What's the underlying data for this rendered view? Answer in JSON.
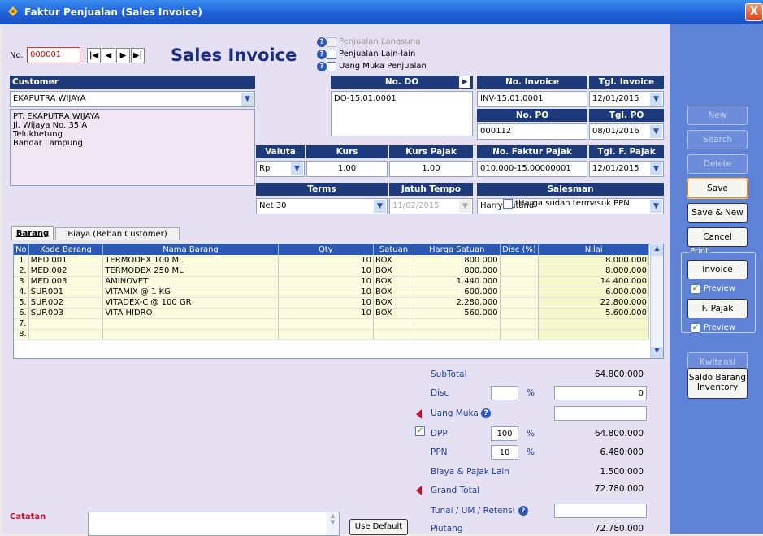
{
  "window": {
    "title": "Faktur Penjualan (Sales Invoice)",
    "close": "X"
  },
  "header": {
    "no_label": "No.",
    "no_value": "000001",
    "title": "Sales Invoice",
    "options": [
      "Penjualan Langsung",
      "Penjualan Lain-lain",
      "Uang Muka Penjualan"
    ]
  },
  "customer": {
    "label": "Customer",
    "name": "EKAPUTRA WIJAYA",
    "address": [
      "PT. EKAPUTRA WIJAYA",
      "Jl. Wijaya No. 35 A",
      "Telukbetung",
      "Bandar Lampung"
    ]
  },
  "do": {
    "label": "No. DO",
    "value": "DO-15.01.0001"
  },
  "invoice": {
    "no_label": "No. Invoice",
    "no_value": "INV-15.01.0001",
    "tgl_label": "Tgl. Invoice",
    "tgl_value": "12/01/2015"
  },
  "po": {
    "no_label": "No. PO",
    "no_value": "000112",
    "tgl_label": "Tgl. PO",
    "tgl_value": "08/01/2016"
  },
  "valuta": {
    "label": "Valuta",
    "value": "Rp"
  },
  "kurs": {
    "label": "Kurs",
    "value": "1,00"
  },
  "kurs_pajak": {
    "label": "Kurs Pajak",
    "value": "1,00"
  },
  "faktur_pajak": {
    "label": "No. Faktur Pajak",
    "value": "010.000-15.00000001",
    "tgl_label": "Tgl. F. Pajak",
    "tgl_value": "12/01/2015"
  },
  "terms": {
    "label": "Terms",
    "value": "Net 30"
  },
  "jatuh_tempo": {
    "label": "Jatuh Tempo",
    "value": "11/02/2015"
  },
  "salesman": {
    "label": "Salesman",
    "value": "Harry Sutandi"
  },
  "ppn_included_label": "*Harga sudah termasuk PPN",
  "tabs": [
    "Barang",
    "Biaya (Beban Customer)"
  ],
  "grid": {
    "columns": [
      "No",
      "Kode Barang",
      "Nama Barang",
      "Qty",
      "Satuan",
      "Harga Satuan",
      "Disc (%)",
      "Nilai"
    ],
    "rows": [
      [
        "1.",
        "MED.001",
        "TERMODEX 100 ML",
        "10",
        "BOX",
        "800.000",
        "",
        "8.000.000"
      ],
      [
        "2.",
        "MED.002",
        "TERMODEX 250 ML",
        "10",
        "BOX",
        "800.000",
        "",
        "8.000.000"
      ],
      [
        "3.",
        "MED.003",
        "AMINOVET",
        "10",
        "BOX",
        "1.440.000",
        "",
        "14.400.000"
      ],
      [
        "4.",
        "SUP.001",
        "VITAMIX @ 1 KG",
        "10",
        "BOX",
        "600.000",
        "",
        "6.000.000"
      ],
      [
        "5.",
        "SUP.002",
        "VITADEX-C @ 100 GR",
        "10",
        "BOX",
        "2.280.000",
        "",
        "22.800.000"
      ],
      [
        "6.",
        "SUP.003",
        "VITA HIDRO",
        "10",
        "BOX",
        "560.000",
        "",
        "5.600.000"
      ],
      [
        "7.",
        "",
        "",
        "",
        "",
        "",
        "",
        ""
      ],
      [
        "8.",
        "",
        "",
        "",
        "",
        "",
        "",
        ""
      ]
    ]
  },
  "totals": {
    "subtotal_label": "SubTotal",
    "subtotal": "64.800.000",
    "disc_label": "Disc",
    "disc_pct_sign": "%",
    "disc_value": "0",
    "uang_muka_label": "Uang Muka",
    "dpp_label": "DPP",
    "dpp_pct": "100",
    "dpp_pct_sign": "%",
    "dpp_value": "64.800.000",
    "ppn_label": "PPN",
    "ppn_pct": "10",
    "ppn_pct_sign": "%",
    "ppn_value": "6.480.000",
    "biaya_label": "Biaya & Pajak Lain",
    "biaya_value": "1.500.000",
    "grand_label": "Grand Total",
    "grand_value": "72.780.000",
    "tunai_label": "Tunai / UM / Retensi",
    "piutang_label": "Piutang",
    "piutang_value": "72.780.000"
  },
  "catatan": {
    "label": "Catatan",
    "use_default": "Use Default"
  },
  "sidebar": {
    "new": "New",
    "search": "Search",
    "delete": "Delete",
    "save": "Save",
    "save_new": "Save & New",
    "cancel": "Cancel",
    "print_label": "Print",
    "invoice": "Invoice",
    "preview": "Preview",
    "fpajak": "F. Pajak",
    "kwitansi": "Kwitansi",
    "saldo": "Saldo Barang Inventory"
  }
}
